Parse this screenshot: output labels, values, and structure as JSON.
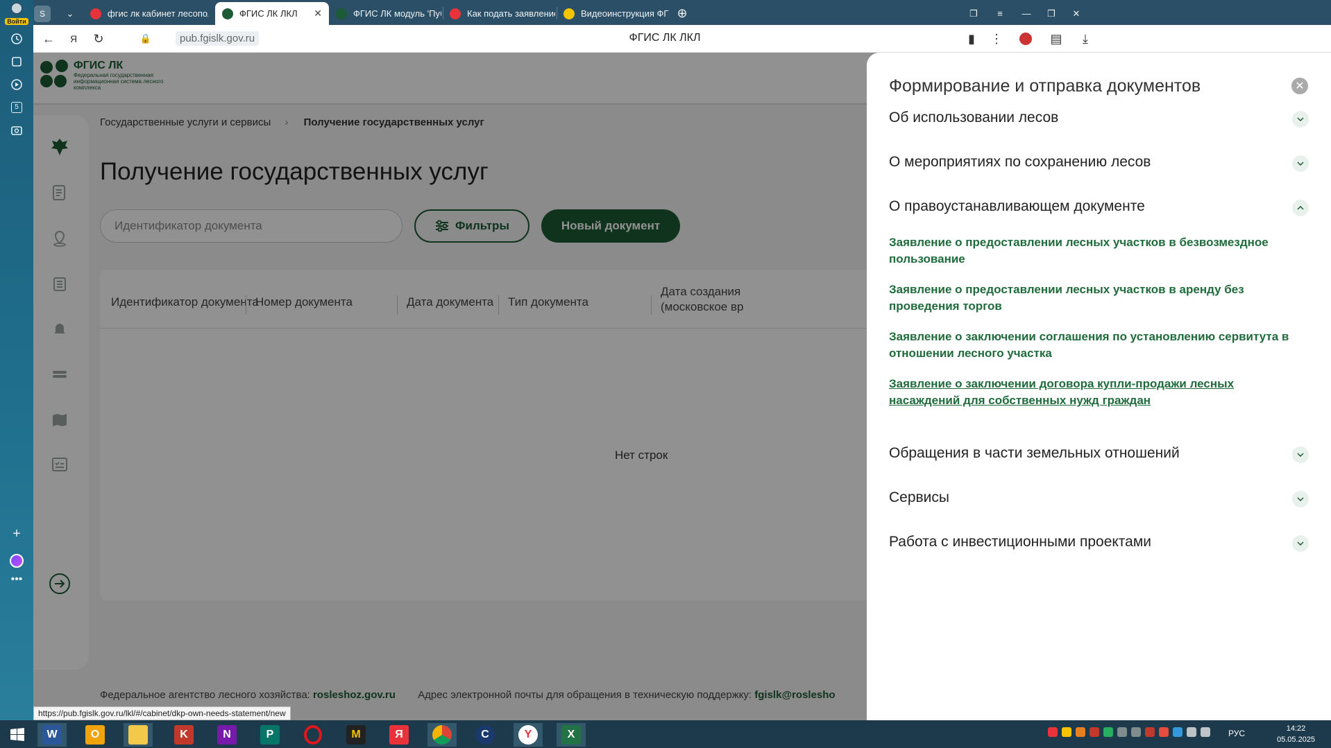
{
  "browser_sidebar": {
    "login_label": "Войти",
    "badge_label": "5"
  },
  "tabs": [
    {
      "title": "фгис лк кабинет лесопол",
      "favicon_color": "#e8333a"
    },
    {
      "title": "ФГИС ЛК ЛКЛ",
      "favicon_color": "#1d5a36",
      "active": true
    },
    {
      "title": "ФГИС ЛК модуль 'Публи",
      "favicon_color": "#1d5a36"
    },
    {
      "title": "Как подать заявление на",
      "favicon_color": "#e8333a"
    },
    {
      "title": "Видеоинструкция ФГИС",
      "favicon_color": "#f5c400"
    }
  ],
  "address_bar": {
    "domain": "pub.fgislk.gov.ru",
    "page_title": "ФГИС ЛК ЛКЛ"
  },
  "site": {
    "logo_title": "ФГИС ЛК",
    "logo_subtitle": "Федеральная государственная информационная система лесного комплекса"
  },
  "breadcrumb": {
    "first": "Государственные услуги и сервисы",
    "current": "Получение государственных услуг"
  },
  "page_heading": "Получение государственных услуг",
  "search": {
    "placeholder": "Идентификатор документа"
  },
  "buttons": {
    "filters": "Фильтры",
    "new_document": "Новый документ"
  },
  "table": {
    "columns": [
      "Идентификатор документа",
      "Номер документа",
      "Дата документа",
      "Тип документа",
      "Дата создания",
      "(московское вр"
    ],
    "empty_text": "Нет строк"
  },
  "footer": {
    "agency_label": "Федеральное агентство лесного хозяйства:",
    "agency_link": "rosleshoz.gov.ru",
    "support_label": "Адрес электронной почты для обращения в техническую поддержку:",
    "support_link": "fgislk@roslesho"
  },
  "status_url": "https://pub.fgislk.gov.ru/lkl/#/cabinet/dkp-own-needs-statement/new",
  "drawer": {
    "title": "Формирование и отправка документов",
    "sections": [
      "Об использовании лесов",
      "О мероприятиях по сохранению лесов",
      "О правоустанавливающем документе",
      "Обращения в части земельных отношений",
      "Сервисы",
      "Работа с инвестиционными проектами"
    ],
    "expanded_links": [
      "Заявление о предоставлении лесных участков в безвозмездное пользование",
      "Заявление о предоставлении лесных участков в аренду без проведения торгов",
      "Заявление о заключении соглашения по установлению сервитута в отношении лесного участка",
      "Заявление о заключении договора купли-продажи лесных насаждений для собственных нужд граждан"
    ]
  },
  "taskbar": {
    "language": "РУС",
    "time": "14:22",
    "date": "05.05.2025"
  }
}
